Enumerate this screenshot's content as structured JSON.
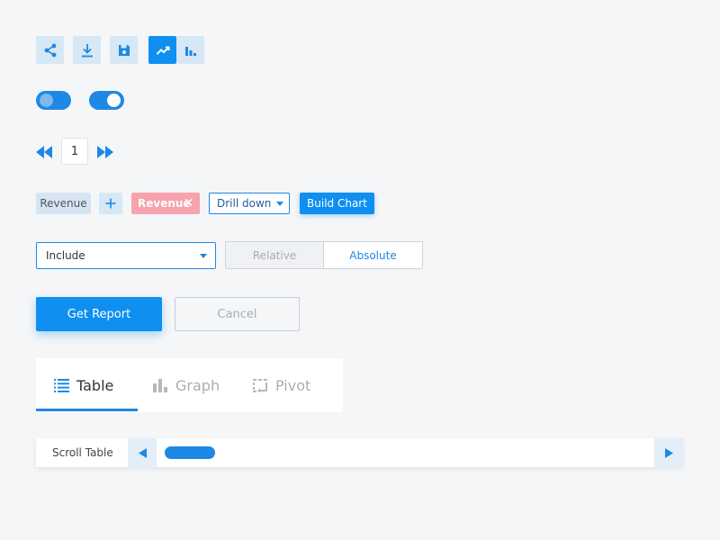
{
  "toolbar": {
    "icons": [
      "share-icon",
      "download-icon",
      "save-icon",
      "line-chart-icon",
      "bar-chart-icon"
    ],
    "active_icon": "line-chart-icon"
  },
  "toggles": [
    {
      "name": "toggle-off",
      "state": "off"
    },
    {
      "name": "toggle-on",
      "state": "on"
    }
  ],
  "pagination": {
    "current_page": "1",
    "prev_icon": "rewind-icon",
    "next_icon": "fast-forward-icon"
  },
  "filters": {
    "tag_label": "Revenue",
    "add_icon": "plus-icon",
    "active_tag_label": "Revenue",
    "active_tag_remove": "×",
    "dropdown_value": "Drill down",
    "build_button": "Build Chart"
  },
  "options": {
    "select_value": "Include",
    "segments": [
      "Relative",
      "Absolute"
    ],
    "selected_segment": "Absolute"
  },
  "actions": {
    "primary": "Get Report",
    "secondary": "Cancel"
  },
  "tabs": {
    "items": [
      {
        "label": "Table",
        "icon": "list-icon"
      },
      {
        "label": "Graph",
        "icon": "bar-chart-icon"
      },
      {
        "label": "Pivot",
        "icon": "pivot-icon"
      }
    ],
    "selected": "Table"
  },
  "scroll": {
    "label": "Scroll Table"
  },
  "colors": {
    "accent": "#0f8ff0",
    "accent_dark": "#1e88e5",
    "icon_bg": "#d6e8f5",
    "tag_red": "#f7a2ad",
    "inactive_text": "#a9adb2"
  }
}
